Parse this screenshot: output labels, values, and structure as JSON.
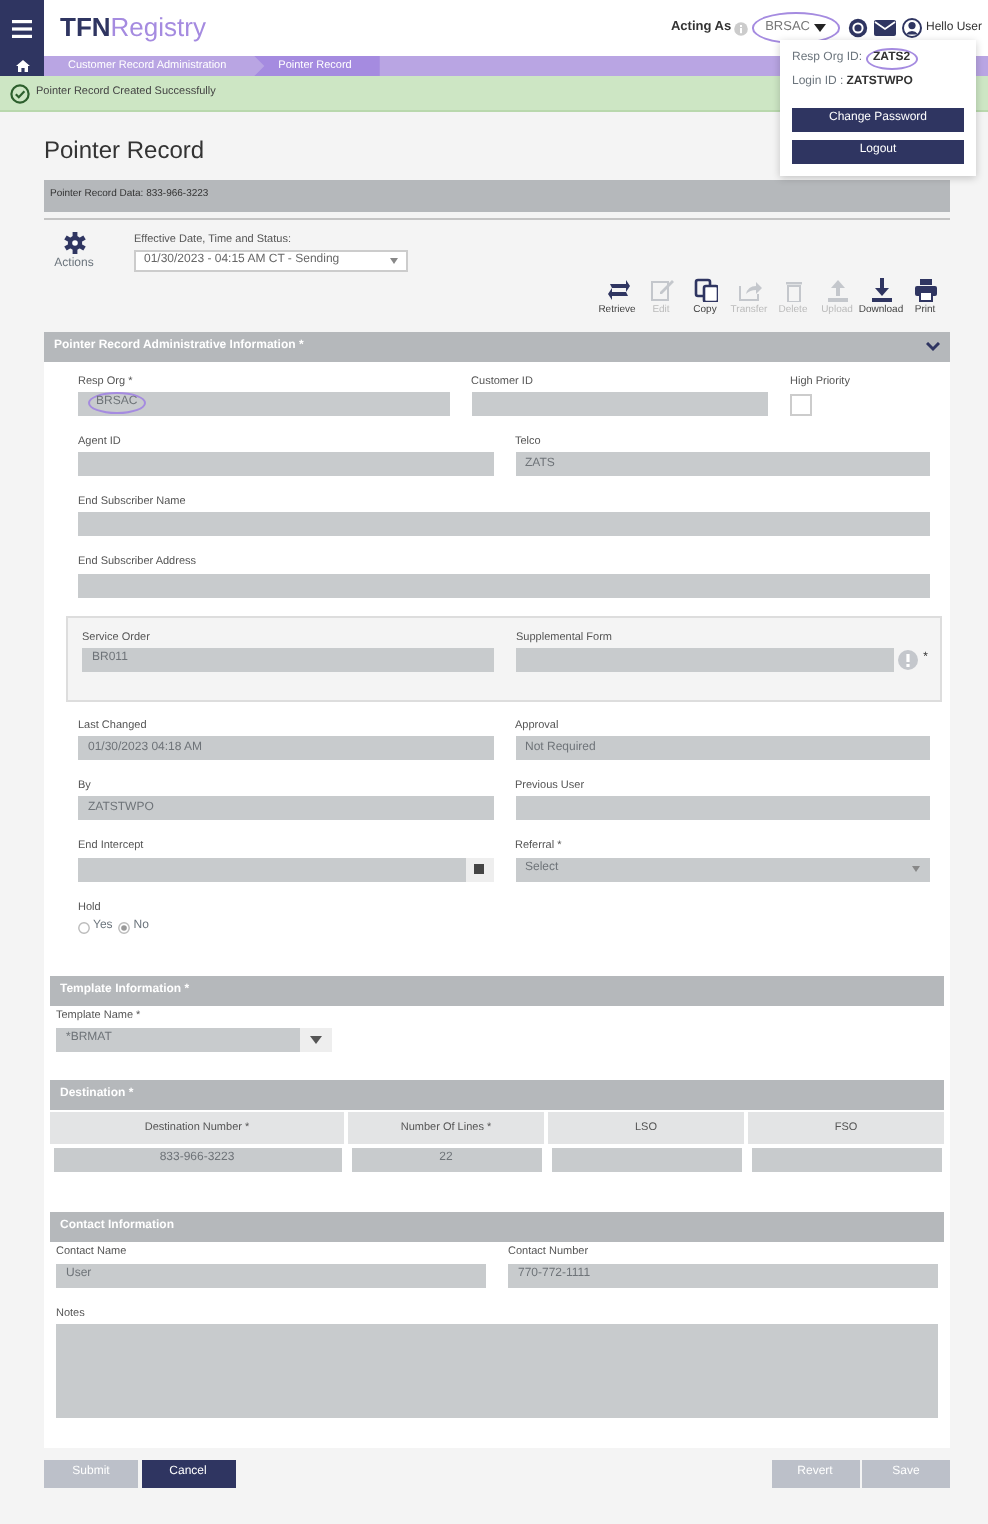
{
  "navbar": {
    "logo_primary": "TFN",
    "logo_secondary": "Registry",
    "acting_as_label": "Acting As",
    "acting_as_value": "BRSAC",
    "greeting": "Hello User"
  },
  "user_menu": {
    "open": true,
    "resp_org_label": "Resp Org ID:",
    "resp_org_value": "ZATS2",
    "login_label": "Login ID :",
    "login_value": "ZATSTWPO",
    "buttons": [
      "Change Password",
      "Logout"
    ]
  },
  "breadcrumb": [
    {
      "label": "Customer Record Administration",
      "selected": false
    },
    {
      "label": "Pointer Record",
      "selected": true
    }
  ],
  "alert": {
    "kind": "success",
    "message": "Pointer Record Created Successfully"
  },
  "page_title": "Pointer Record",
  "record_bar": "Pointer Record Data: 833-966-3223",
  "actions": {
    "label": "Actions"
  },
  "effective": {
    "label": "Effective Date, Time and Status:",
    "value": "01/30/2023 - 04:15 AM CT - Sending"
  },
  "toolbar": [
    {
      "kind": "retrieve",
      "label": "Retrieve",
      "disabled": false
    },
    {
      "kind": "edit",
      "label": "Edit",
      "disabled": true
    },
    {
      "kind": "copy",
      "label": "Copy",
      "disabled": false
    },
    {
      "kind": "transfer",
      "label": "Transfer",
      "disabled": true
    },
    {
      "kind": "delete",
      "label": "Delete",
      "disabled": true
    },
    {
      "kind": "upload",
      "label": "Upload",
      "disabled": true
    },
    {
      "kind": "download",
      "label": "Download",
      "disabled": false
    },
    {
      "kind": "print",
      "label": "Print",
      "disabled": false
    }
  ],
  "sections": [
    {
      "title": "Pointer Record Administrative Information *",
      "expanded": true,
      "kind": "form",
      "blocks": [
        {
          "kind": "row",
          "fields": [
            {
              "kind": "text",
              "label": "Resp Org *",
              "value": "BRSAC",
              "circled": true
            },
            {
              "kind": "text",
              "label": "Customer ID"
            },
            {
              "kind": "checkbox",
              "label": "High Priority",
              "checked": false
            }
          ]
        },
        {
          "kind": "row",
          "fields": [
            {
              "kind": "text",
              "label": "Agent ID"
            },
            {
              "kind": "text",
              "label": "Telco",
              "value": "ZATS"
            }
          ]
        },
        {
          "kind": "row",
          "fields": [
            {
              "kind": "text",
              "label": "End Subscriber Name"
            }
          ]
        },
        {
          "kind": "row",
          "fields": [
            {
              "kind": "text",
              "label": "End Subscriber Address"
            }
          ]
        },
        {
          "kind": "group",
          "fields": [
            {
              "kind": "text",
              "label": "Service Order",
              "value": "BR011"
            },
            {
              "kind": "text",
              "label": "Supplemental Form",
              "warning": true,
              "suffix": "*"
            }
          ]
        },
        {
          "kind": "row",
          "fields": [
            {
              "kind": "text",
              "label": "Last Changed",
              "value": "01/30/2023 04:18 AM"
            },
            {
              "kind": "text",
              "label": "Approval",
              "value": "Not Required"
            }
          ]
        },
        {
          "kind": "row",
          "fields": [
            {
              "kind": "text",
              "label": "By",
              "value": "ZATSTWPO"
            },
            {
              "kind": "text",
              "label": "Previous User"
            }
          ]
        },
        {
          "kind": "row",
          "fields": [
            {
              "kind": "date",
              "label": "End Intercept"
            },
            {
              "kind": "select",
              "label": "Referral *",
              "value": "Select"
            }
          ]
        },
        {
          "kind": "radio",
          "label": "Hold",
          "options": [
            {
              "label": "Yes",
              "selected": false
            },
            {
              "label": "No",
              "selected": true
            }
          ]
        }
      ]
    },
    {
      "title": "Template Information *",
      "kind": "form",
      "blocks": [
        {
          "kind": "row",
          "fields": [
            {
              "kind": "combo",
              "label": "Template Name *",
              "value": "*BRMAT"
            }
          ]
        }
      ]
    },
    {
      "title": "Destination *",
      "kind": "table",
      "columns": [
        {
          "label": "Destination Number *",
          "value": "833-966-3223"
        },
        {
          "label": "Number Of Lines *",
          "value": "22"
        },
        {
          "label": "LSO"
        },
        {
          "label": "FSO"
        }
      ]
    },
    {
      "title": "Contact Information",
      "kind": "form",
      "blocks": [
        {
          "kind": "row",
          "fields": [
            {
              "kind": "text",
              "label": "Contact Name",
              "value": "User"
            },
            {
              "kind": "text",
              "label": "Contact Number",
              "value": "770-772-1111"
            }
          ]
        },
        {
          "kind": "row",
          "fields": [
            {
              "kind": "textarea",
              "label": "Notes"
            }
          ]
        }
      ]
    }
  ],
  "footer": {
    "left": [
      {
        "label": "Submit",
        "disabled": true
      },
      {
        "label": "Cancel",
        "disabled": false
      }
    ],
    "right": [
      {
        "label": "Revert",
        "disabled": true
      },
      {
        "label": "Save",
        "disabled": true
      }
    ]
  }
}
